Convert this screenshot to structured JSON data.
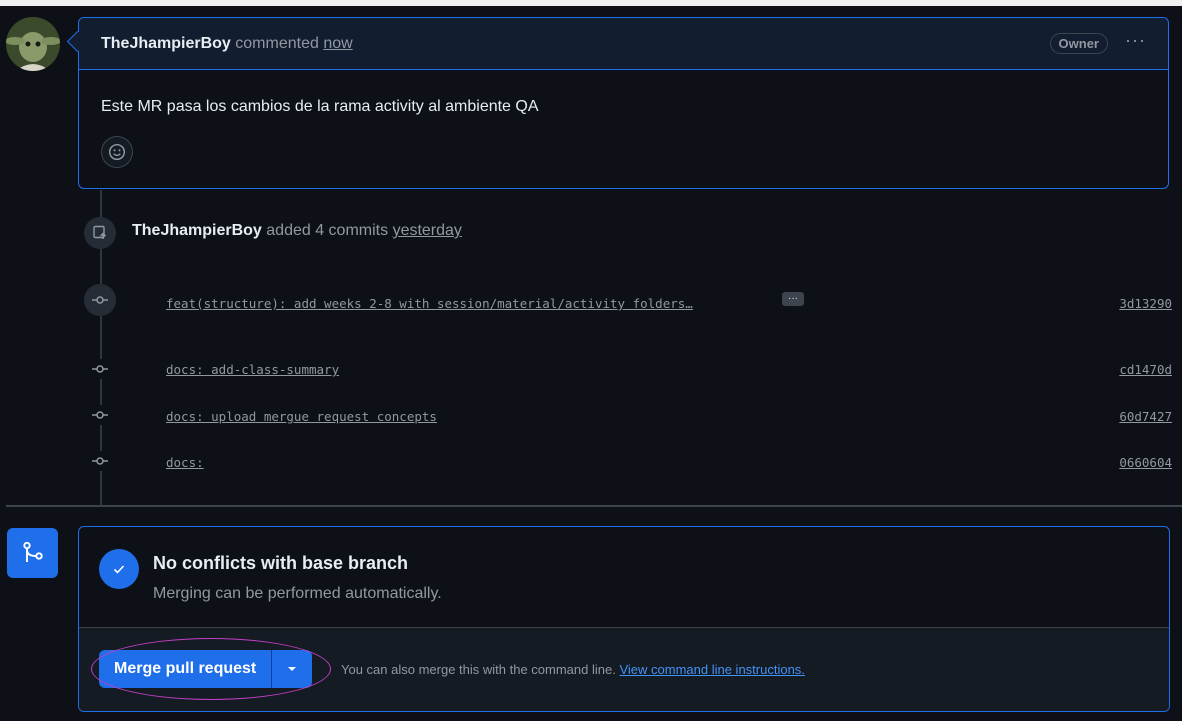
{
  "comment": {
    "author": "TheJhampierBoy",
    "action": "commented",
    "time": "now",
    "badge": "Owner",
    "menu": "···",
    "body": "Este MR pasa los cambios de la rama activity al ambiente QA"
  },
  "push_event": {
    "author": "TheJhampierBoy",
    "action": "added 4 commits",
    "time": "yesterday"
  },
  "commits": [
    {
      "message": "feat(structure): add weeks 2-8 with session/material/activity folders…",
      "sha": "3d13290"
    },
    {
      "message": "docs: add-class-summary",
      "sha": "cd1470d"
    },
    {
      "message": "docs: upload mergue request concepts",
      "sha": "60d7427"
    },
    {
      "message": "docs:",
      "sha": "0660604"
    }
  ],
  "commit_more": "···",
  "merge": {
    "status_title": "No conflicts with base branch",
    "status_sub": "Merging can be performed automatically.",
    "button_label": "Merge pull request",
    "hint": "You can also merge this with the command line.",
    "hint_link": "View command line instructions."
  },
  "icons": {
    "avatar": "yoda-avatar",
    "emoji": "smiley-icon",
    "push": "repo-push-icon",
    "commit": "git-commit-icon",
    "merge": "git-merge-icon",
    "check": "check-icon",
    "caret": "triangle-down-icon"
  },
  "colors": {
    "accent": "#1f6feb",
    "link": "#4493f8",
    "highlight": "#c23fc7"
  }
}
